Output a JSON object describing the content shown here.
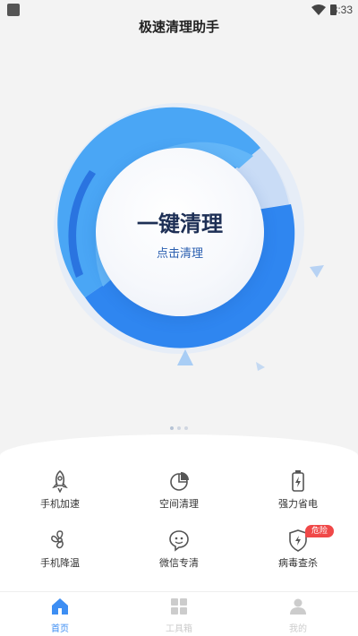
{
  "status_bar": {
    "time": "3:33",
    "icons": [
      "app-icon",
      "wifi-icon",
      "battery-icon"
    ]
  },
  "header": {
    "title": "极速清理助手"
  },
  "hero": {
    "main_label": "一键清理",
    "sub_label": "点击清理",
    "colors": {
      "ring_dark": "#2f86f0",
      "ring_light": "#4aa6f5",
      "ring_pale": "#c9dcf6",
      "halo": "#e6edf7"
    }
  },
  "tools": [
    {
      "label": "手机加速",
      "icon": "rocket-icon"
    },
    {
      "label": "空间清理",
      "icon": "pie-chart-icon"
    },
    {
      "label": "强力省电",
      "icon": "battery-saver-icon"
    },
    {
      "label": "手机降温",
      "icon": "fan-icon"
    },
    {
      "label": "微信专清",
      "icon": "chat-bubble-icon"
    },
    {
      "label": "病毒查杀",
      "icon": "shield-icon",
      "badge": "危险"
    }
  ],
  "tabs": [
    {
      "label": "首页",
      "icon": "home-icon",
      "active": true
    },
    {
      "label": "工具箱",
      "icon": "grid-icon",
      "active": false
    },
    {
      "label": "我的",
      "icon": "user-icon",
      "active": false
    }
  ],
  "accent_color": "#3d8ef3",
  "badge_color": "#f04848"
}
